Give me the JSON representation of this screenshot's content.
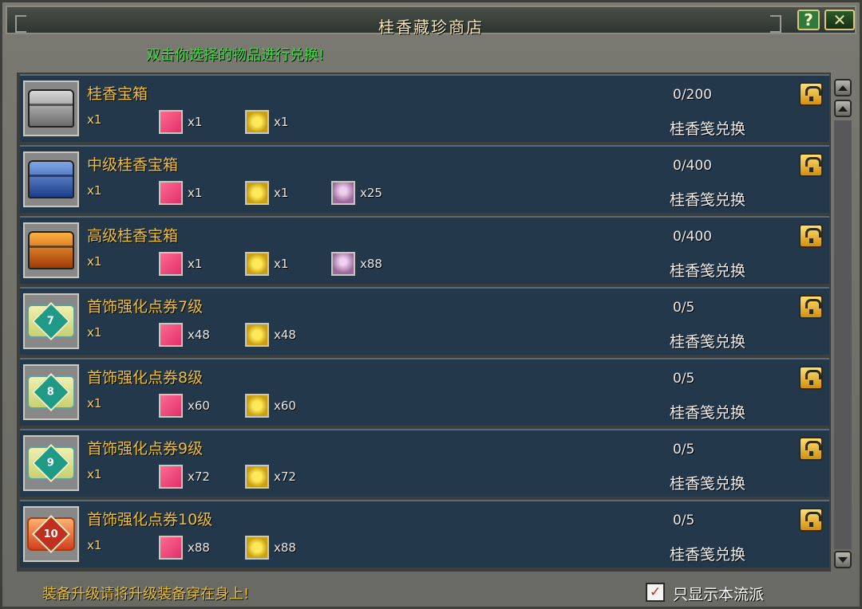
{
  "window": {
    "title": "桂香藏珍商店",
    "help_label": "?",
    "close_label": "✕"
  },
  "instruction": "双击你选择的物品进行兑换!",
  "items": [
    {
      "name": "桂香宝箱",
      "icon": "silver-chest-icon",
      "qty": "x1",
      "materials": [
        {
          "icon": "pink-gem-icon",
          "qty": "x1"
        },
        {
          "icon": "gold-pouch-icon",
          "qty": "x1"
        }
      ],
      "limit": "0/200",
      "exchange": "桂香笺兑换"
    },
    {
      "name": "中级桂香宝箱",
      "icon": "blue-chest-icon",
      "qty": "x1",
      "materials": [
        {
          "icon": "pink-gem-icon",
          "qty": "x1"
        },
        {
          "icon": "gold-pouch-icon",
          "qty": "x1"
        },
        {
          "icon": "crystal-icon",
          "qty": "x25"
        }
      ],
      "limit": "0/400",
      "exchange": "桂香笺兑换"
    },
    {
      "name": "高级桂香宝箱",
      "icon": "orange-chest-icon",
      "qty": "x1",
      "materials": [
        {
          "icon": "pink-gem-icon",
          "qty": "x1"
        },
        {
          "icon": "gold-pouch-icon",
          "qty": "x1"
        },
        {
          "icon": "crystal-icon",
          "qty": "x88"
        }
      ],
      "limit": "0/400",
      "exchange": "桂香笺兑换"
    },
    {
      "name": "首饰强化点券7级",
      "icon": "voucher-scroll-icon",
      "badge": "7",
      "qty": "x1",
      "materials": [
        {
          "icon": "pink-gem-icon",
          "qty": "x48"
        },
        {
          "icon": "gold-pouch-icon",
          "qty": "x48"
        }
      ],
      "limit": "0/5",
      "exchange": "桂香笺兑换"
    },
    {
      "name": "首饰强化点券8级",
      "icon": "voucher-scroll-icon",
      "badge": "8",
      "qty": "x1",
      "materials": [
        {
          "icon": "pink-gem-icon",
          "qty": "x60"
        },
        {
          "icon": "gold-pouch-icon",
          "qty": "x60"
        }
      ],
      "limit": "0/5",
      "exchange": "桂香笺兑换"
    },
    {
      "name": "首饰强化点券9级",
      "icon": "voucher-scroll-icon",
      "badge": "9",
      "qty": "x1",
      "materials": [
        {
          "icon": "pink-gem-icon",
          "qty": "x72"
        },
        {
          "icon": "gold-pouch-icon",
          "qty": "x72"
        }
      ],
      "limit": "0/5",
      "exchange": "桂香笺兑换"
    },
    {
      "name": "首饰强化点券10级",
      "icon": "voucher-scroll-icon",
      "badge": "10",
      "qty": "x1",
      "materials": [
        {
          "icon": "pink-gem-icon",
          "qty": "x88"
        },
        {
          "icon": "gold-pouch-icon",
          "qty": "x88"
        }
      ],
      "limit": "0/5",
      "exchange": "桂香笺兑换"
    }
  ],
  "footer": {
    "note": "装备升级请将升级装备穿在身上!",
    "checkbox_label": "只显示本流派",
    "checkbox_checked": true,
    "check_mark": "✓"
  },
  "colors": {
    "item_name": "#f0c03a",
    "instruction": "#38e03a",
    "row_bg": "#24384c"
  }
}
